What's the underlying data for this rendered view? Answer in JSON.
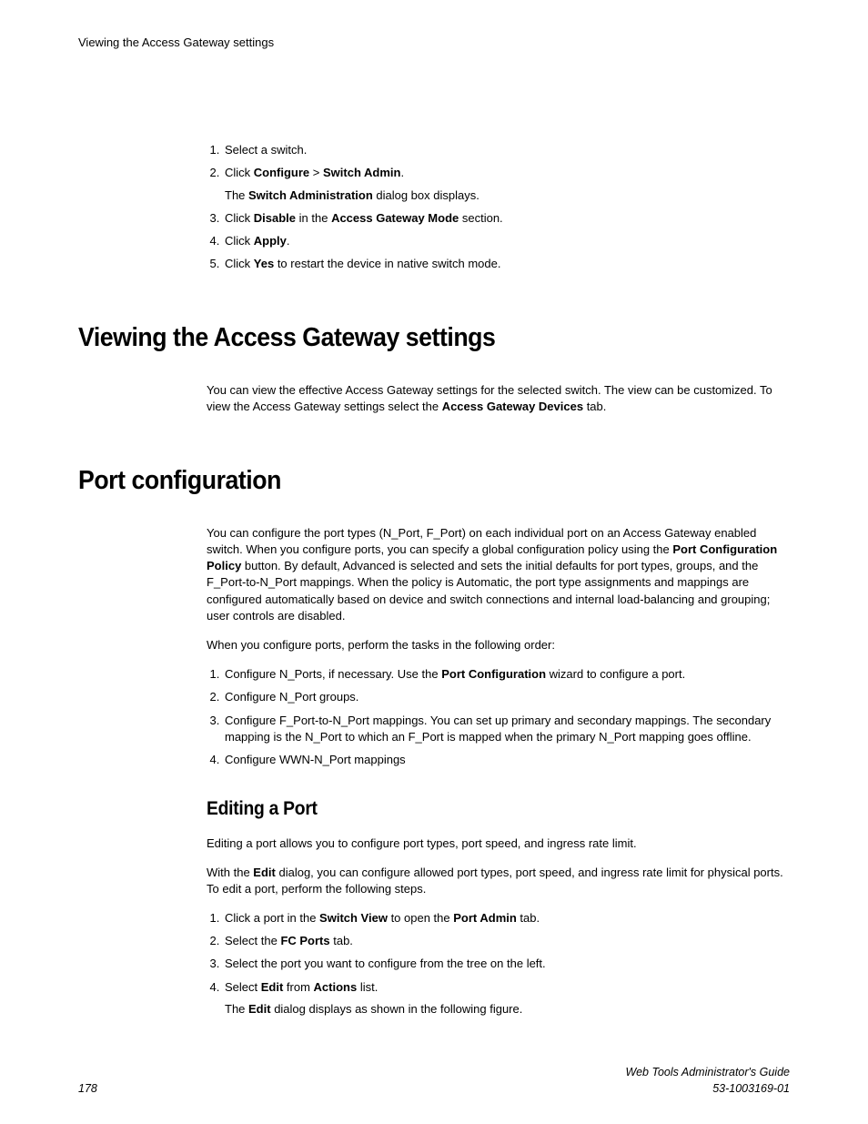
{
  "runningHead": "Viewing the Access Gateway settings",
  "stepsTop": {
    "s1": "Select a switch.",
    "s2_pre": "Click ",
    "s2_b1": "Configure",
    "s2_mid": "  > ",
    "s2_b2": "Switch Admin",
    "s2_post": ".",
    "s2_sub_pre": "The ",
    "s2_sub_b": "Switch Administration",
    "s2_sub_post": " dialog box displays.",
    "s3_pre": "Click ",
    "s3_b1": "Disable",
    "s3_mid": " in the ",
    "s3_b2": "Access Gateway Mode",
    "s3_post": " section.",
    "s4_pre": "Click ",
    "s4_b": "Apply",
    "s4_post": ".",
    "s5_pre": "Click ",
    "s5_b": "Yes",
    "s5_post": " to restart the device in native switch mode."
  },
  "h1a": "Viewing the Access Gateway settings",
  "p1_pre": "You can view the effective Access Gateway settings for the selected switch. The view can be customized. To view the Access Gateway settings select the ",
  "p1_b": "Access Gateway Devices",
  "p1_post": " tab.",
  "h1b": "Port configuration",
  "p2_pre": "You can configure the port types (N_Port, F_Port) on each individual port on an Access Gateway enabled switch. When you configure ports, you can specify a global configuration policy using the ",
  "p2_b": "Port Configuration Policy",
  "p2_post": " button. By default, Advanced is selected and sets the initial defaults for port types, groups, and the F_Port-to-N_Port mappings. When the policy is Automatic, the port type assignments and mappings are configured automatically based on device and switch connections and internal load-balancing and grouping; user controls are disabled.",
  "p3": "When you configure ports, perform the tasks in the following order:",
  "stepsMid": {
    "s1_pre": "Configure N_Ports, if necessary. Use the ",
    "s1_b": "Port Configuration",
    "s1_post": " wizard to configure a port.",
    "s2": "Configure N_Port groups.",
    "s3": "Configure F_Port-to-N_Port mappings. You can set up primary and secondary mappings. The secondary mapping is the N_Port to which an F_Port is mapped when the primary N_Port mapping goes offline.",
    "s4": "Configure WWN-N_Port mappings"
  },
  "h2a": "Editing a Port",
  "p4": "Editing a port allows you to configure port types, port speed, and ingress rate limit.",
  "p5_pre": "With the ",
  "p5_b": "Edit",
  "p5_post": " dialog, you can configure allowed port types, port speed, and ingress rate limit for physical ports. To edit a port, perform the following steps.",
  "stepsBot": {
    "s1_pre": "Click a port in the ",
    "s1_b1": "Switch View",
    "s1_mid": " to open the ",
    "s1_b2": "Port Admin",
    "s1_post": " tab.",
    "s2_pre": "Select the ",
    "s2_b": "FC Ports",
    "s2_post": " tab.",
    "s3": "Select the port you want to configure from the tree on the left.",
    "s4_pre": "Select ",
    "s4_b1": "Edit",
    "s4_mid": " from ",
    "s4_b2": "Actions",
    "s4_post": " list.",
    "s4_sub_pre": "The ",
    "s4_sub_b": "Edit",
    "s4_sub_post": " dialog displays as shown in the following figure."
  },
  "footer": {
    "pageNum": "178",
    "guide": "Web Tools Administrator's Guide",
    "docId": "53-1003169-01"
  }
}
